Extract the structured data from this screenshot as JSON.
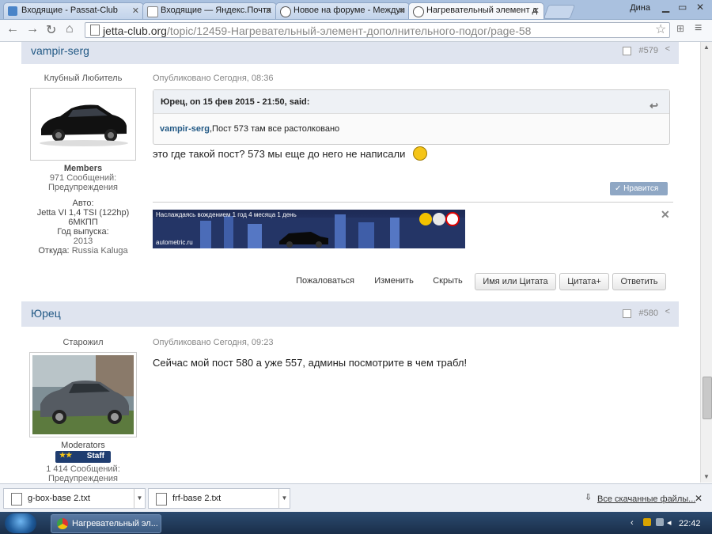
{
  "browser": {
    "tabs": [
      {
        "label": "Входящие - Passat-Club",
        "active": false
      },
      {
        "label": "Входящие — Яндекс.Почта",
        "active": false
      },
      {
        "label": "Новое на форуме - Междун",
        "active": false
      },
      {
        "label": "Нагревательный элемент д",
        "active": true
      }
    ],
    "user": "Дина",
    "url_domain": "jetta-club.org",
    "url_path": "/topic/12459-Нагревательный-элемент-дополнительного-подог/page-58"
  },
  "posts": [
    {
      "author": "vampir-serg",
      "number": "#579",
      "title": "Клубный Любитель",
      "group": "Members",
      "messages": "971 Сообщений:",
      "warnings": "Предупреждения",
      "car_label": "Авто:",
      "car": "Jetta VI 1,4 TSI (122hp) 6МКПП",
      "year_label": "Год выпуска:",
      "year": "2013",
      "from_label": "Откуда:",
      "from": "Russia Kaluga",
      "date": "Опубликовано Сегодня, 08:36",
      "quote_head": "Юрец, on 15 фев 2015 - 21:50, said:",
      "quote_author": "vampir-serg",
      "quote_text": ",Пост 573 там все растолковано",
      "body": "это где такой пост? 573 мы еще до него не написали",
      "like_label": "Нравится",
      "banner_text": "Наслаждаясь вождением 1 год 4 месяца 1 день",
      "banner_site": "autometric.ru",
      "actions": [
        "Пожаловаться",
        "Изменить",
        "Скрыть",
        "Имя или Цитата",
        "Цитата+",
        "Ответить"
      ]
    },
    {
      "author": "Юрец",
      "number": "#580",
      "title": "Старожил",
      "group": "Moderators",
      "badge": "Staff",
      "messages": "1 414 Сообщений:",
      "warnings": "Предупреждения",
      "date": "Опубликовано Сегодня, 09:23",
      "body": "Сейчас мой пост 580 а уже 557, админы посмотрите в чем трабл!"
    }
  ],
  "downloads": {
    "files": [
      "g-box-base 2.txt",
      "frf-base 2.txt"
    ],
    "all_label": "Все скачанные файлы..."
  },
  "taskbar": {
    "task_label": "Нагревательный эл...",
    "clock": "22:42"
  },
  "colors": {
    "link": "#225985",
    "header_bg": "#dfe4ef",
    "tabstrip": "#aac1df"
  }
}
